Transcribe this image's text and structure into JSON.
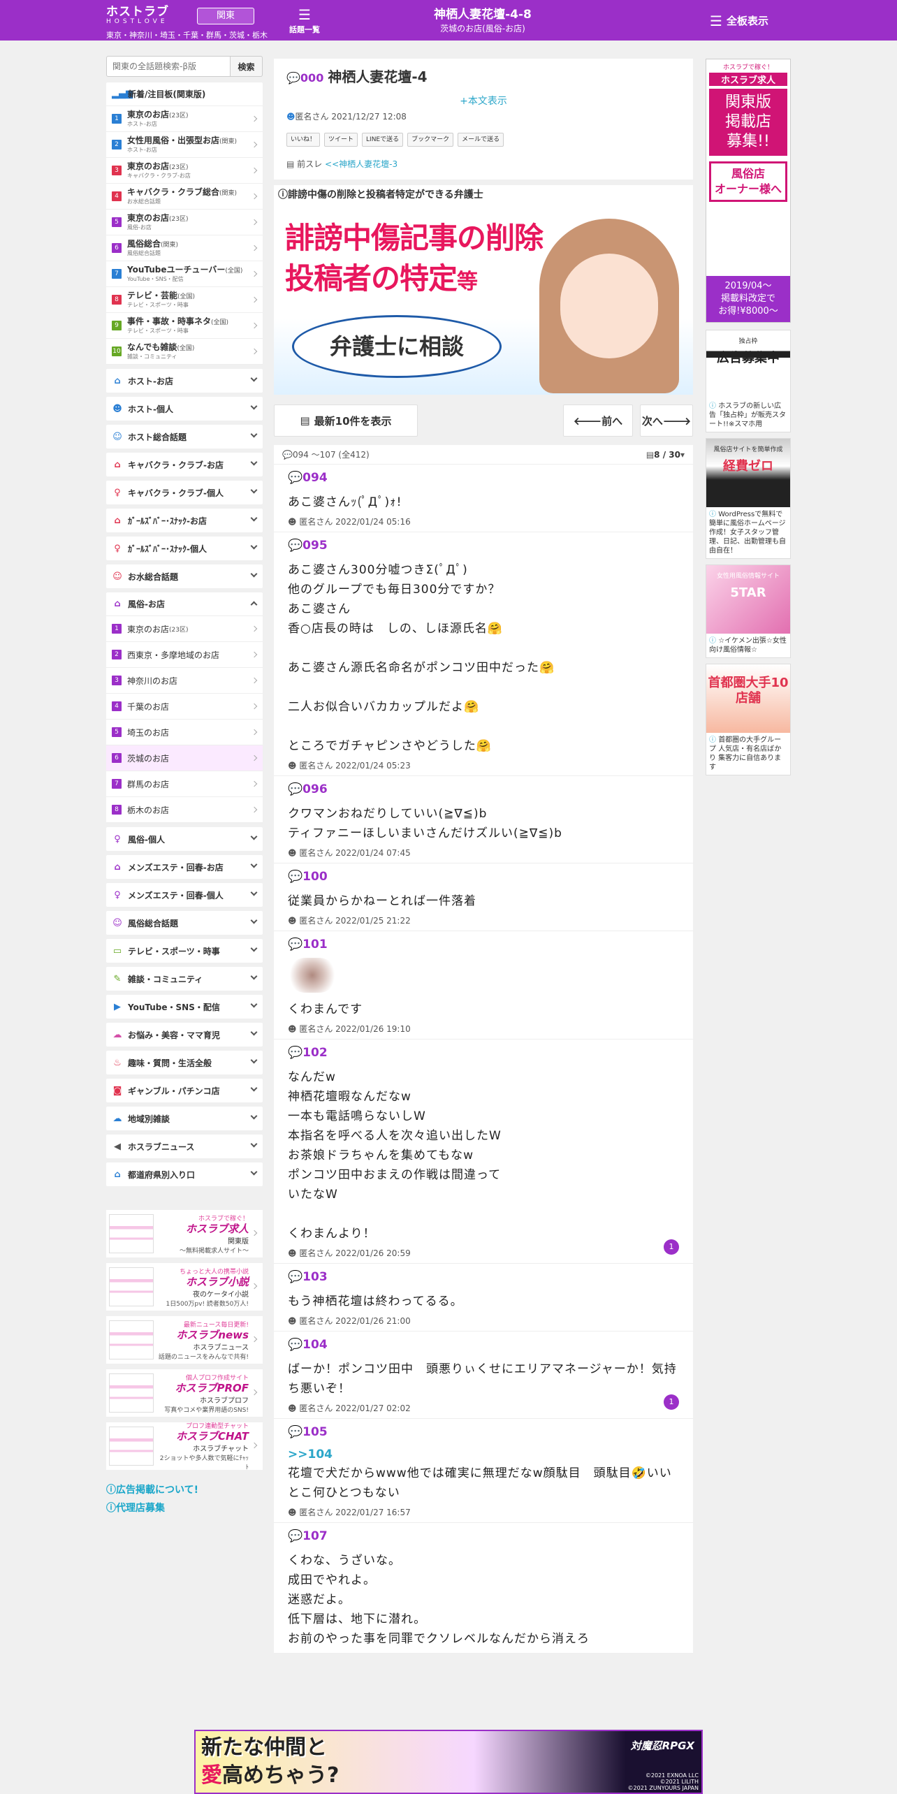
{
  "header": {
    "logo_main": "ホストラブ",
    "logo_sub": "HOSTLOVE",
    "region_button": "関東",
    "areas": "東京・神奈川・埼玉・千葉・群馬・茨城・栃木",
    "topics_label": "話題一覧",
    "title": "神栖人妻花壇-4-8",
    "subtitle": "茨城のお店(風俗-お店)",
    "menu_label": "全板表示"
  },
  "search": {
    "placeholder": "関東の全話題検索-β版",
    "button": "検索"
  },
  "sidebar": {
    "new_panel_title": "新着/注目板(関東版)",
    "new_items": [
      {
        "num": "1",
        "color": "#2a7fd4",
        "label": "東京のお店",
        "suffix": "(23区)",
        "sub": "ホスト-お店"
      },
      {
        "num": "2",
        "color": "#2a7fd4",
        "label": "女性用風俗・出張型お店",
        "suffix": "(関東)",
        "sub": "ホスト-お店"
      },
      {
        "num": "3",
        "color": "#e0334f",
        "label": "東京のお店",
        "suffix": "(23区)",
        "sub": "キャバクラ・クラブ-お店"
      },
      {
        "num": "4",
        "color": "#e0334f",
        "label": "キャバクラ・クラブ総合",
        "suffix": "(関東)",
        "sub": "お水総合話題"
      },
      {
        "num": "5",
        "color": "#9b2fc8",
        "label": "東京のお店",
        "suffix": "(23区)",
        "sub": "風俗-お店"
      },
      {
        "num": "6",
        "color": "#9b2fc8",
        "label": "風俗総合",
        "suffix": "(関東)",
        "sub": "風俗総合話題"
      },
      {
        "num": "7",
        "color": "#2a7fd4",
        "label": "YouTubeユーチューバー",
        "suffix": "(全国)",
        "sub": "YouTube・SNS・配信"
      },
      {
        "num": "8",
        "color": "#e0334f",
        "label": "テレビ・芸能",
        "suffix": "(全国)",
        "sub": "テレビ・スポーツ・時事"
      },
      {
        "num": "9",
        "color": "#66a824",
        "label": "事件・事故・時事ネタ",
        "suffix": "(全国)",
        "sub": "テレビ・スポーツ・時事"
      },
      {
        "num": "10",
        "color": "#66a824",
        "label": "なんでも雑談",
        "suffix": "(全国)",
        "sub": "雑談・コミュニティ"
      }
    ],
    "cat_a": [
      {
        "icon": "⌂",
        "color": "#2a7fd4",
        "label": "ホスト-お店"
      },
      {
        "icon": "☻",
        "color": "#2a7fd4",
        "label": "ホスト-個人"
      },
      {
        "icon": "☺",
        "color": "#2a7fd4",
        "label": "ホスト総合話題"
      },
      {
        "icon": "⌂",
        "color": "#e0334f",
        "label": "キャバクラ・クラブ-お店"
      },
      {
        "icon": "♀",
        "color": "#e0334f",
        "label": "キャバクラ・クラブ-個人"
      },
      {
        "icon": "⌂",
        "color": "#e0334f",
        "label": "ｶﾞｰﾙｽﾞﾊﾞｰ･ｽﾅｯｸ-お店"
      },
      {
        "icon": "♀",
        "color": "#e0334f",
        "label": "ｶﾞｰﾙｽﾞﾊﾞｰ･ｽﾅｯｸ-個人"
      },
      {
        "icon": "☺",
        "color": "#e0334f",
        "label": "お水総合話題"
      }
    ],
    "fuzoku_title": "風俗-お店",
    "fuzoku_items": [
      {
        "num": "1",
        "label": "東京のお店",
        "suffix": "(23区)"
      },
      {
        "num": "2",
        "label": "西東京・多摩地域のお店",
        "suffix": ""
      },
      {
        "num": "3",
        "label": "神奈川のお店",
        "suffix": ""
      },
      {
        "num": "4",
        "label": "千葉のお店",
        "suffix": ""
      },
      {
        "num": "5",
        "label": "埼玉のお店",
        "suffix": ""
      },
      {
        "num": "6",
        "label": "茨城のお店",
        "suffix": ""
      },
      {
        "num": "7",
        "label": "群馬のお店",
        "suffix": ""
      },
      {
        "num": "8",
        "label": "栃木のお店",
        "suffix": ""
      }
    ],
    "cat_b": [
      {
        "icon": "♀",
        "color": "#9b2fc8",
        "label": "風俗-個人"
      },
      {
        "icon": "⌂",
        "color": "#9b2fc8",
        "label": "メンズエステ・回春-お店"
      },
      {
        "icon": "♀",
        "color": "#9b2fc8",
        "label": "メンズエステ・回春-個人"
      },
      {
        "icon": "☺",
        "color": "#9b2fc8",
        "label": "風俗総合話題"
      },
      {
        "icon": "▭",
        "color": "#66a824",
        "label": "テレビ・スポーツ・時事"
      },
      {
        "icon": "✎",
        "color": "#66a824",
        "label": "雑談・コミュニティ"
      },
      {
        "icon": "▶",
        "color": "#2a7fd4",
        "label": "YouTube・SNS・配信"
      },
      {
        "icon": "☁",
        "color": "#d44fa8",
        "label": "お悩み・美容・ママ育児"
      },
      {
        "icon": "♨",
        "color": "#e0334f",
        "label": "趣味・質問・生活全般"
      },
      {
        "icon": "◙",
        "color": "#e0334f",
        "label": "ギャンブル・パチンコ店"
      },
      {
        "icon": "☁",
        "color": "#2a7fd4",
        "label": "地域別雑談"
      },
      {
        "icon": "◀",
        "color": "#555555",
        "label": "ホスラブニュース"
      },
      {
        "icon": "⌂",
        "color": "#2a7fd4",
        "label": "都道府県別入り口"
      }
    ],
    "promos": [
      {
        "p1": "ホスラブで稼ぐ！",
        "p2": "ホスラブ求人",
        "p3": "関東版",
        "p4": "〜無料掲載求人サイト〜"
      },
      {
        "p1": "ちょっと大人の携帯小説",
        "p2": "ホスラブ小説",
        "p3": "夜のケータイ小説",
        "p4": "1日500万pv! 読者数50万人!"
      },
      {
        "p1": "最新ニュース毎日更新!",
        "p2": "ホスラブnews",
        "p3": "ホスラブニュース",
        "p4": "話題のニュースをみんなで共有!"
      },
      {
        "p1": "個人プロフ作成サイト",
        "p2": "ホスラブPROF",
        "p3": "ホスラブプロフ",
        "p4": "写真やコメや業界用語のSNS!"
      },
      {
        "p1": "プロフ連動型チャット",
        "p2": "ホスラブCHAT",
        "p3": "ホスラブチャット",
        "p4": "2ショットや多人数で気軽にﾁｬｯﾄ"
      }
    ],
    "ad_link": "広告掲載について!",
    "agency_link": "代理店募集"
  },
  "thread": {
    "num": "000",
    "title": "神栖人妻花壇-4",
    "show_body": "+本文表示",
    "author": "匿名さん",
    "date": "2021/12/27 12:08",
    "share": [
      "いいね！",
      "ツイート",
      "LINEで送る",
      "ブックマーク",
      "メールで送る"
    ],
    "prev_label": "前スレ",
    "prev_link": "<<神栖人妻花壇-3"
  },
  "lawyer": {
    "heading": "誹謗中傷の削除と投稿者特定ができる弁護士",
    "line1": "誹謗中傷記事の削除",
    "line2": "投稿者の特定",
    "line2b": "等",
    "line3": "弁護士に相談"
  },
  "pager": {
    "latest": "最新10件を表示",
    "prev": "前へ",
    "next": "次へ"
  },
  "posts_head": {
    "range": "094 ～107 (全412)",
    "page": "8 / 30"
  },
  "posts": [
    {
      "num": "094",
      "text": "あこ婆さんｯ(ﾟДﾟ)ｫ!",
      "author": "匿名さん",
      "date": "2022/01/24 05:16"
    },
    {
      "num": "095",
      "text": "あこ婆さん300分嘘つきΣ(ﾟДﾟ)\n他のグループでも毎日300分ですか？\nあこ婆さん\n香○店長の時は　しの、しほ源氏名🤗\n\nあこ婆さん源氏名命名がポンコツ田中だった🤗\n\n二人お似合いバカカップルだよ🤗\n\nところでガチャピンさやどうした🤗",
      "author": "匿名さん",
      "date": "2022/01/24 05:23"
    },
    {
      "num": "096",
      "text": "クワマンおねだりしていい(≧∇≦)b\nティファニーほしいまいさんだけズルい(≧∇≦)b",
      "author": "匿名さん",
      "date": "2022/01/24 07:45"
    },
    {
      "num": "100",
      "text": "従業員からかねーとれば一件落着",
      "author": "匿名さん",
      "date": "2022/01/25 21:22"
    },
    {
      "num": "101",
      "text": "くわまんです",
      "author": "匿名さん",
      "date": "2022/01/26 19:10"
    },
    {
      "num": "102",
      "text": "なんだw\n神栖花壇暇なんだなw\n一本も電話鳴らないしW\n本指名を呼べる人を次々追い出したW\nお茶娘ドラちゃんを集めてもなw\nポンコツ田中おまえの作戦は間違って\nいたなW\n\nくわまんより！",
      "author": "匿名さん",
      "date": "2022/01/26 20:59",
      "replies": "1"
    },
    {
      "num": "103",
      "text": "もう神栖花壇は終わってるる。",
      "author": "匿名さん",
      "date": "2022/01/26 21:00"
    },
    {
      "num": "104",
      "text": "ばーか！ポンコツ田中　頭悪りぃくせにエリアマネージャーか！気持ち悪いぞ！",
      "author": "匿名さん",
      "date": "2022/01/27 02:02",
      "replies": "1"
    },
    {
      "num": "105",
      "anchor": ">>104",
      "text": "花壇で犬だからwww他では確実に無理だなw顔駄目　頭駄目🤣いいとこ何ひとつもない",
      "author": "匿名さん",
      "date": "2022/01/27 16:57"
    },
    {
      "num": "107",
      "text": "くわな、うざいな。\n成田でやれよ。\n迷惑だよ。\n低下層は、地下に潜れ。\nお前のやった事を同罪でクソレベルなんだから消えろ",
      "author": "",
      "date": ""
    }
  ],
  "right": {
    "ad1": {
      "a1": "ホスラブで稼ぐ！",
      "a2": "ホスラブ求人",
      "a3": "関東版\n掲載店\n募集!!",
      "a4": "風俗店\nオーナー様へ",
      "a5": "2019/04〜\n掲載料改定で\nお得!¥8000〜"
    },
    "ads": [
      {
        "img_title": "広告募集中",
        "img_sub": "独占枠",
        "text": "ホスラブの新しい広告「独占枠」が販売スタート!!※スマホ用"
      },
      {
        "img_title": "経費ゼロ",
        "img_sub": "風俗店サイトを簡単作成",
        "text": "WordPressで無料で簡単に風俗ホームページ作成！女子スタッフ管理、日記、出勤管理も自由自在！"
      },
      {
        "img_title": "5TAR",
        "img_sub": "女性用風俗情報サイト",
        "text": "☆イケメン出張☆女性向け風俗情報☆"
      },
      {
        "img_title": "首都圏大手10店舗",
        "img_sub": "",
        "text": "首都圏の大手グループ 人気店・有名店ばかり 集客力に自信あります"
      }
    ]
  },
  "bottom_ad": {
    "line1": "新たな仲間と",
    "line2a": "愛",
    "line2b": "高めちゃう?",
    "logo": "対魔忍RPGX",
    "copy": "©2021 EXNOA LLC\n©2021 LILITH\n©2021 ZUNYOURS JAPAN"
  },
  "colors": {
    "brand": "#9b2fc8",
    "link": "#2ba6c9",
    "accent_pink": "#d01475"
  }
}
